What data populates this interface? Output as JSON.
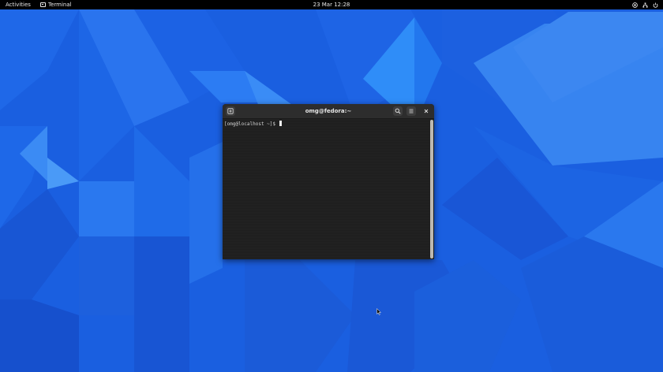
{
  "colors": {
    "wallpaper_base": "#1a5fe0",
    "topbar_bg": "#000000",
    "terminal_bg": "#1e1e1e",
    "terminal_header": "#2d2d2d",
    "scrollbar": "#bdb9b0"
  },
  "topbar": {
    "activities_label": "Activities",
    "app_name": "Terminal",
    "app_icon": "terminal-icon",
    "clock": "23 Mar  12:28",
    "tray_icons": [
      "accessibility-icon",
      "network-icon",
      "power-icon"
    ]
  },
  "terminal": {
    "title": "omg@fedora:~",
    "prompt": "[omg@localhost ~]$ ",
    "header_icons": [
      "new-tab-icon",
      "search-icon",
      "hamburger-menu-icon",
      "close-icon"
    ]
  }
}
